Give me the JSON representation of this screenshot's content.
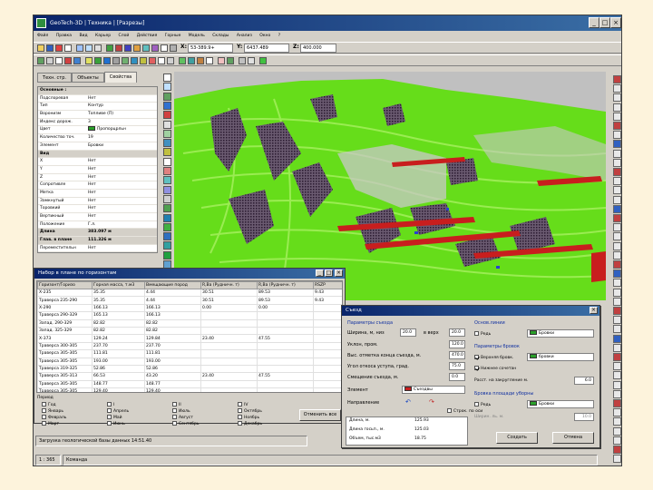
{
  "app": {
    "title": "GeoTech-3D | Техника | [Разрезы]",
    "menu": [
      "Файл",
      "Правка",
      "Вид",
      "Карьер",
      "Слой",
      "Действия",
      "Горные",
      "Модель",
      "Склады",
      "Анализ",
      "Окно",
      "?"
    ],
    "coord_x_label": "X:",
    "coord_x_value": "53-389.9+",
    "coord_y_label": "Y:",
    "coord_y_value": "6437.489",
    "coord_z_label": "Z:",
    "coord_z_value": "400.000"
  },
  "left_panel": {
    "tabs": [
      "Техн. стр.",
      "Объекты",
      "Свойства"
    ],
    "active_tab": 2,
    "rows": [
      {
        "type": "group",
        "k": "Основные :"
      },
      {
        "k": "Подслоревая",
        "v": "Нет"
      },
      {
        "k": "Тип",
        "v": "Контур"
      },
      {
        "k": "Воронизм",
        "v": "Топливе (П)"
      },
      {
        "k": "Индекс дорож.",
        "v": "3"
      },
      {
        "k": "Цвет",
        "v": "Пропорцрльн",
        "swatch": true
      },
      {
        "k": "Количество точ.",
        "v": "19"
      },
      {
        "k": "Элемент",
        "v": "Бровки"
      },
      {
        "type": "group",
        "k": "Вид"
      },
      {
        "k": "X",
        "v": "Нет"
      },
      {
        "k": "Y",
        "v": "Нет"
      },
      {
        "k": "Z",
        "v": "Нет"
      },
      {
        "k": "Сопротивле",
        "v": "Нет"
      },
      {
        "k": "Метка",
        "v": "Нет"
      },
      {
        "k": "Замкнутый",
        "v": "Нет"
      },
      {
        "k": "Торовкий",
        "v": "Нет"
      },
      {
        "k": "Вертикный",
        "v": "Нет"
      },
      {
        "k": "Положение",
        "v": "Г.л."
      },
      {
        "type": "group",
        "k": "Длина",
        "v": "383.097 м"
      },
      {
        "type": "group",
        "k": "Глав. в плане",
        "v": "111.326 м"
      },
      {
        "k": "Переместительн",
        "v": "Нет"
      }
    ]
  },
  "orebody_window": {
    "title": "Набор в плане по горизонтам",
    "columns": [
      "Горизонт/Горизо",
      "Горная масса, т.м3",
      "Вмещающие пород",
      "R,Ba (Рудничн. т)",
      "R,Ba (Рудничн. т)",
      "RSZP"
    ],
    "rows": [
      [
        "Х-235",
        "35.35",
        "4.44",
        "30.51",
        "89.53",
        "9.43"
      ],
      [
        "Траверса 235-290",
        "35.35",
        "4.44",
        "30.51",
        "89.53",
        "9.43"
      ],
      [
        "Х-290",
        "166.13",
        "166.13",
        "0.00",
        "0.00",
        ""
      ],
      [
        "Траверса 290-329",
        "165.13",
        "166.13",
        "",
        "",
        ""
      ],
      [
        "Запад. 290-329",
        "82.82",
        "82.82",
        "",
        "",
        ""
      ],
      [
        "Запад. 325-329",
        "82.82",
        "82.82",
        "",
        "",
        ""
      ],
      [
        "Х-373",
        "129.24",
        "129.84",
        "23.40",
        "47.55",
        ""
      ],
      [
        "Траверса 300-305",
        "237.70",
        "237.70",
        "",
        "",
        ""
      ],
      [
        "Траверса 305-305",
        "111.81",
        "111.81",
        "",
        "",
        ""
      ],
      [
        "Траверса 305-305",
        "193.00",
        "193.00",
        "",
        "",
        ""
      ],
      [
        "Траверса 319-325",
        "52.86",
        "52.86",
        "",
        "",
        ""
      ],
      [
        "Траверса 305-313",
        "66.53",
        "43.20",
        "23.40",
        "47.55",
        ""
      ],
      [
        "Траверса 305-305",
        "148.77",
        "148.77",
        "",
        "",
        ""
      ],
      [
        "Траверса 305-305",
        "129.40",
        "129.40",
        "",
        "",
        ""
      ]
    ],
    "period_label": "Период",
    "col1": [
      {
        "l": "Год",
        "on": false
      },
      {
        "l": "Январь",
        "on": false
      },
      {
        "l": "Февраль",
        "on": false
      },
      {
        "l": "Март",
        "on": false
      }
    ],
    "col2": [
      {
        "l": "I",
        "on": false
      },
      {
        "l": "Апрель",
        "on": false
      },
      {
        "l": "Май",
        "on": false
      },
      {
        "l": "Июнь",
        "on": false
      }
    ],
    "col3": [
      {
        "l": "II",
        "on": false
      },
      {
        "l": "Июль",
        "on": false
      },
      {
        "l": "Август",
        "on": false
      },
      {
        "l": "Сентябрь",
        "on": false
      }
    ],
    "col4": [
      {
        "l": "IV",
        "on": false
      },
      {
        "l": "Октябрь",
        "on": false
      },
      {
        "l": "Ноябрь",
        "on": false
      },
      {
        "l": "Декабрь",
        "on": false
      }
    ],
    "apply_button": "Отменить все"
  },
  "dialog": {
    "title": "Съезд",
    "params_header": "Параметры съезда",
    "width_label": "Ширина, м, низ",
    "width_value": "20.0",
    "top_label": "в верх",
    "top_value": "20.0",
    "angle_label": "Уклон, пром.",
    "angle_value": "120.0",
    "elev_end_label": "Выс. отметка конца съезда, м.",
    "elev_end_value": "470.0",
    "slope_label": "Угол откоса уступа, град.",
    "slope_value": "75.0",
    "offset_label": "Смещение съезда, м.",
    "offset_value": "0.0",
    "element_label": "Элемент",
    "element_value": "Съездвы",
    "direction_label": "Направление",
    "curve_label": "Строк. по оси",
    "length_label": "Длина, м.",
    "length_value": "125.93",
    "proj_label": "Длина госьп., м.",
    "proj_value": "125.03",
    "volume_label": "Объем, тыс.м3",
    "volume_value": "18.75",
    "base_lines_header": "Основ.линии",
    "base_line_chk": "Редь",
    "base_line_value": "Бровки",
    "crest_header": "Параметры бровок",
    "upper_chk": "Верхняя бровк.",
    "upper_value": "бровки",
    "lower_chk": "Нижнее сочетан",
    "dist_label": "Расст. на закругление м.",
    "dist_value": "6.0",
    "drill_header": "Бровка площади уборны",
    "drill_chk": "Редь",
    "drill_value": "Бровки",
    "drill_dist_label": "Ширин. ль. м.",
    "drill_dist_value": "10.0",
    "create_button": "Создать",
    "cancel_button": "Отмена"
  },
  "status": {
    "message": "Загрузка геологической базы данных 14:51.40",
    "cell_a": "1 : 365",
    "cell_b": "Команда"
  }
}
